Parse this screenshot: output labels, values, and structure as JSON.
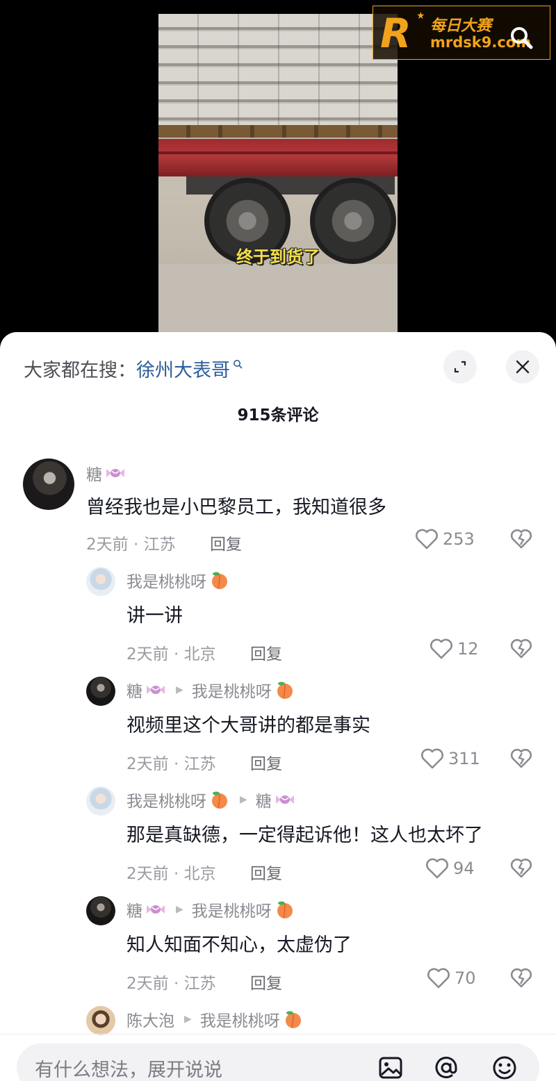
{
  "video": {
    "subtitle": "终于到货了"
  },
  "watermark": {
    "title": "每日大赛",
    "url": "mrdsk9.com",
    "logo_letter": "R"
  },
  "comments_panel": {
    "search_prefix": "大家都在搜：",
    "search_term": "徐州大表哥",
    "count_title": "915条评论",
    "reply_label": "回复",
    "comments": [
      {
        "author": "糖",
        "text": "曾经我也是小巴黎员工，我知道很多",
        "meta": "2天前 · 江苏",
        "likes": "253"
      },
      {
        "author": "我是桃桃呀",
        "text": "讲一讲",
        "meta": "2天前 · 北京",
        "likes": "12"
      },
      {
        "author": "糖",
        "reply_to": "我是桃桃呀",
        "text": "视频里这个大哥讲的都是事实",
        "meta": "2天前 · 江苏",
        "likes": "311"
      },
      {
        "author": "我是桃桃呀",
        "reply_to": "糖",
        "text": "那是真缺德，一定得起诉他！这人也太坏了",
        "meta": "2天前 · 北京",
        "likes": "94"
      },
      {
        "author": "糖",
        "reply_to": "我是桃桃呀",
        "text": "知人知面不知心，太虚伪了",
        "meta": "2天前 · 江苏",
        "likes": "70"
      },
      {
        "author": "陈大泡",
        "reply_to": "我是桃桃呀"
      }
    ]
  },
  "input_bar": {
    "placeholder": "有什么想法，展开说说"
  },
  "colors": {
    "accent_link": "#2d5d9a",
    "watermark_orange": "#f1a31b",
    "subtitle_yellow": "#f5e04a"
  }
}
